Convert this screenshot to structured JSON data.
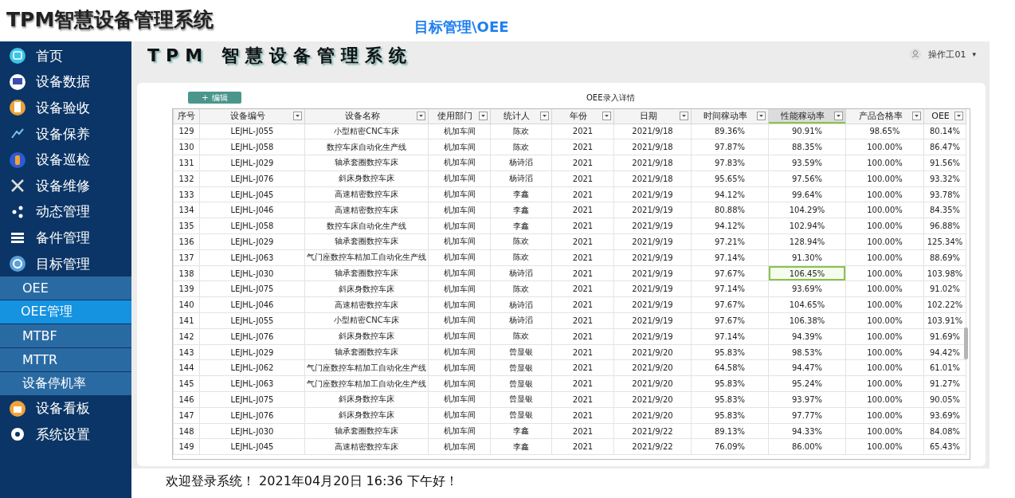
{
  "app_title": "TPM智慧设备管理系统",
  "breadcrumb": "目标管理\\OEE",
  "banner_title": "TPM 智慧设备管理系统",
  "user": {
    "name": "操作工01",
    "caret": "▾"
  },
  "sidebar": {
    "items": [
      {
        "label": "首页"
      },
      {
        "label": "设备数据"
      },
      {
        "label": "设备验收"
      },
      {
        "label": "设备保养"
      },
      {
        "label": "设备巡检"
      },
      {
        "label": "设备维修"
      },
      {
        "label": "动态管理"
      },
      {
        "label": "备件管理"
      },
      {
        "label": "目标管理",
        "children": [
          {
            "label": "OEE",
            "selected": false
          },
          {
            "label": "OEE管理",
            "selected": true
          },
          {
            "label": "MTBF",
            "selected": false
          },
          {
            "label": "MTTR",
            "selected": false
          },
          {
            "label": "设备停机率",
            "selected": false
          }
        ]
      },
      {
        "label": "设备看板"
      },
      {
        "label": "系统设置"
      }
    ]
  },
  "edit_button": {
    "label": "编辑",
    "icon": "+"
  },
  "table": {
    "caption": "OEE录入详情",
    "columns": [
      {
        "label": "序号",
        "filter": false,
        "selected": false
      },
      {
        "label": "设备编号",
        "filter": true,
        "selected": false
      },
      {
        "label": "设备名称",
        "filter": true,
        "selected": false
      },
      {
        "label": "使用部门",
        "filter": true,
        "selected": false
      },
      {
        "label": "统计人",
        "filter": true,
        "selected": false
      },
      {
        "label": "年份",
        "filter": true,
        "selected": false
      },
      {
        "label": "日期",
        "filter": true,
        "selected": false
      },
      {
        "label": "时间稼动率",
        "filter": true,
        "selected": false
      },
      {
        "label": "性能稼动率",
        "filter": true,
        "selected": true
      },
      {
        "label": "产品合格率",
        "filter": true,
        "selected": false
      },
      {
        "label": "OEE",
        "filter": true,
        "selected": false
      }
    ],
    "rows": [
      {
        "selected": false,
        "cells": [
          "129",
          "LEJHL-J055",
          "小型精密CNC车床",
          "机加车间",
          "陈欢",
          "2021",
          "2021/9/18",
          "89.36%",
          "90.91%",
          "98.65%",
          "80.14%"
        ]
      },
      {
        "selected": false,
        "cells": [
          "130",
          "LEJHL-J058",
          "数控车床自动化生产线",
          "机加车间",
          "陈欢",
          "2021",
          "2021/9/18",
          "97.87%",
          "88.35%",
          "100.00%",
          "86.47%"
        ]
      },
      {
        "selected": false,
        "cells": [
          "131",
          "LEJHL-J029",
          "轴承套圈数控车床",
          "机加车间",
          "杨诗滔",
          "2021",
          "2021/9/18",
          "97.83%",
          "93.59%",
          "100.00%",
          "91.56%"
        ]
      },
      {
        "selected": false,
        "cells": [
          "132",
          "LEJHL-J076",
          "斜床身数控车床",
          "机加车间",
          "杨诗滔",
          "2021",
          "2021/9/18",
          "95.65%",
          "97.56%",
          "100.00%",
          "93.32%"
        ]
      },
      {
        "selected": false,
        "cells": [
          "133",
          "LEJHL-J045",
          "高速精密数控车床",
          "机加车间",
          "李鑫",
          "2021",
          "2021/9/19",
          "94.12%",
          "99.64%",
          "100.00%",
          "93.78%"
        ]
      },
      {
        "selected": false,
        "cells": [
          "134",
          "LEJHL-J046",
          "高速精密数控车床",
          "机加车间",
          "李鑫",
          "2021",
          "2021/9/19",
          "80.88%",
          "104.29%",
          "100.00%",
          "84.35%"
        ]
      },
      {
        "selected": false,
        "cells": [
          "135",
          "LEJHL-J058",
          "数控车床自动化生产线",
          "机加车间",
          "李鑫",
          "2021",
          "2021/9/19",
          "94.12%",
          "102.94%",
          "100.00%",
          "96.88%"
        ]
      },
      {
        "selected": false,
        "cells": [
          "136",
          "LEJHL-J029",
          "轴承套圈数控车床",
          "机加车间",
          "陈欢",
          "2021",
          "2021/9/19",
          "97.21%",
          "128.94%",
          "100.00%",
          "125.34%"
        ]
      },
      {
        "selected": false,
        "cells": [
          "137",
          "LEJHL-J063",
          "气门座数控车精加工自动化生产线",
          "机加车间",
          "陈欢",
          "2021",
          "2021/9/19",
          "97.14%",
          "91.30%",
          "100.00%",
          "88.69%"
        ]
      },
      {
        "selected": true,
        "cells": [
          "138",
          "LEJHL-J030",
          "轴承套圈数控车床",
          "机加车间",
          "杨诗滔",
          "2021",
          "2021/9/19",
          "97.67%",
          "106.45%",
          "100.00%",
          "103.98%"
        ]
      },
      {
        "selected": false,
        "cells": [
          "139",
          "LEJHL-J075",
          "斜床身数控车床",
          "机加车间",
          "陈欢",
          "2021",
          "2021/9/19",
          "97.14%",
          "93.69%",
          "100.00%",
          "91.02%"
        ]
      },
      {
        "selected": false,
        "cells": [
          "140",
          "LEJHL-J046",
          "高速精密数控车床",
          "机加车间",
          "杨诗滔",
          "2021",
          "2021/9/19",
          "97.67%",
          "104.65%",
          "100.00%",
          "102.22%"
        ]
      },
      {
        "selected": false,
        "cells": [
          "141",
          "LEJHL-J055",
          "小型精密CNC车床",
          "机加车间",
          "杨诗滔",
          "2021",
          "2021/9/19",
          "97.67%",
          "106.38%",
          "100.00%",
          "103.91%"
        ]
      },
      {
        "selected": false,
        "cells": [
          "142",
          "LEJHL-J076",
          "斜床身数控车床",
          "机加车间",
          "陈欢",
          "2021",
          "2021/9/19",
          "97.14%",
          "94.39%",
          "100.00%",
          "91.69%"
        ]
      },
      {
        "selected": false,
        "cells": [
          "143",
          "LEJHL-J029",
          "轴承套圈数控车床",
          "机加车间",
          "曾显银",
          "2021",
          "2021/9/20",
          "95.83%",
          "98.53%",
          "100.00%",
          "94.42%"
        ]
      },
      {
        "selected": false,
        "cells": [
          "144",
          "LEJHL-J062",
          "气门座数控车精加工自动化生产线",
          "机加车间",
          "曾显银",
          "2021",
          "2021/9/20",
          "64.58%",
          "94.47%",
          "100.00%",
          "61.01%"
        ]
      },
      {
        "selected": false,
        "cells": [
          "145",
          "LEJHL-J063",
          "气门座数控车精加工自动化生产线",
          "机加车间",
          "曾显银",
          "2021",
          "2021/9/20",
          "95.83%",
          "95.24%",
          "100.00%",
          "91.27%"
        ]
      },
      {
        "selected": false,
        "cells": [
          "146",
          "LEJHL-J075",
          "斜床身数控车床",
          "机加车间",
          "曾显银",
          "2021",
          "2021/9/20",
          "95.83%",
          "93.97%",
          "100.00%",
          "90.05%"
        ]
      },
      {
        "selected": false,
        "cells": [
          "147",
          "LEJHL-J076",
          "斜床身数控车床",
          "机加车间",
          "曾显银",
          "2021",
          "2021/9/20",
          "95.83%",
          "97.77%",
          "100.00%",
          "93.69%"
        ]
      },
      {
        "selected": false,
        "cells": [
          "148",
          "LEJHL-J030",
          "轴承套圈数控车床",
          "机加车间",
          "李鑫",
          "2021",
          "2021/9/22",
          "89.13%",
          "94.33%",
          "100.00%",
          "84.08%"
        ]
      },
      {
        "selected": false,
        "cells": [
          "149",
          "LEJHL-J045",
          "高速精密数控车床",
          "机加车间",
          "李鑫",
          "2021",
          "2021/9/22",
          "76.09%",
          "86.00%",
          "100.00%",
          "65.43%"
        ]
      }
    ]
  },
  "footer": "欢迎登录系统！ 2021年04月20日 16:36 下午好！"
}
